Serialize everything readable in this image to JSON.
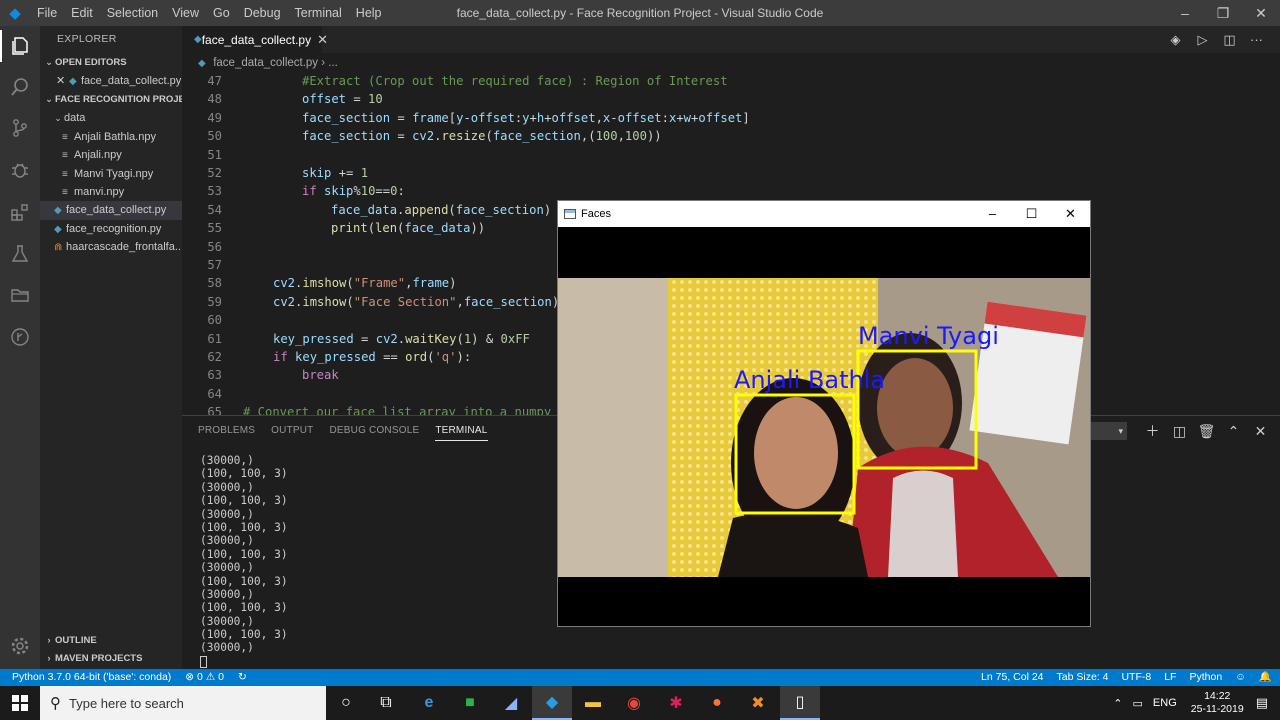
{
  "titlebar": {
    "menu": [
      "File",
      "Edit",
      "Selection",
      "View",
      "Go",
      "Debug",
      "Terminal",
      "Help"
    ],
    "title": "face_data_collect.py - Face Recognition Project - Visual Studio Code"
  },
  "sidebar": {
    "title": "EXPLORER",
    "open_editors": {
      "label": "OPEN EDITORS",
      "files": [
        "face_data_collect.py"
      ]
    },
    "project": {
      "label": "FACE RECOGNITION PROJE...",
      "folder": "data",
      "data_files": [
        "Anjali Bathla.npy",
        "Anjali.npy",
        "Manvi Tyagi.npy",
        "manvi.npy"
      ],
      "files": [
        "face_data_collect.py",
        "face_recognition.py",
        "haarcascade_frontalfa..."
      ]
    },
    "outline": "OUTLINE",
    "maven": "MAVEN PROJECTS"
  },
  "editor": {
    "tab": "face_data_collect.py",
    "breadcrumb": "face_data_collect.py",
    "breadcrumb_more": "...",
    "line_numbers": [
      "47",
      "48",
      "49",
      "50",
      "51",
      "52",
      "53",
      "54",
      "55",
      "56",
      "57",
      "58",
      "59",
      "60",
      "61",
      "62",
      "63",
      "64",
      "65"
    ]
  },
  "panel": {
    "tabs": [
      "PROBLEMS",
      "OUTPUT",
      "DEBUG CONSOLE",
      "TERMINAL"
    ],
    "active_tab": "TERMINAL",
    "terminal_lines": [
      "(30000,)",
      "(100, 100, 3)",
      "(30000,)",
      "(100, 100, 3)",
      "(30000,)",
      "(100, 100, 3)",
      "(30000,)",
      "(100, 100, 3)",
      "(30000,)",
      "(100, 100, 3)",
      "(30000,)",
      "(100, 100, 3)",
      "(30000,)",
      "(100, 100, 3)",
      "(30000,)"
    ]
  },
  "statusbar": {
    "interpreter": "Python 3.7.0 64-bit ('base': conda)",
    "problems": "⊗ 0 ⚠ 0",
    "position": "Ln 75, Col 24",
    "tab_size": "Tab Size: 4",
    "encoding": "UTF-8",
    "eol": "LF",
    "language": "Python"
  },
  "faces_window": {
    "title": "Faces",
    "labels": [
      "Anjali Bathla",
      "Manvi Tyagi"
    ]
  },
  "taskbar": {
    "search_placeholder": "Type here to search",
    "lang": "ENG",
    "time": "14:22",
    "date": "25-11-2019"
  },
  "colors": {
    "statusbar": "#007acc",
    "box": "#ffff00",
    "label": "#1a1aff"
  }
}
